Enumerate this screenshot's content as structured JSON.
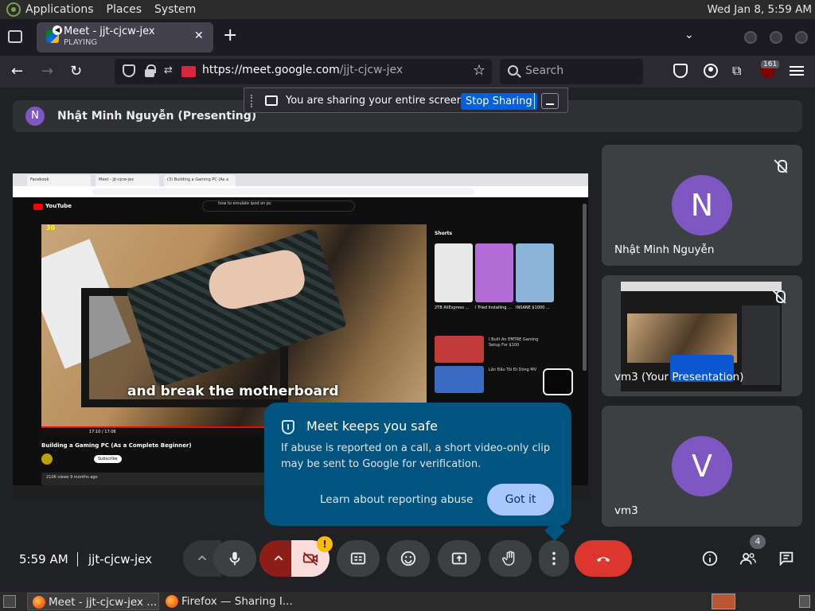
{
  "desktop": {
    "menus": [
      "Applications",
      "Places",
      "System"
    ],
    "clock": "Wed Jan  8,  5:59 AM"
  },
  "browser": {
    "tab": {
      "title": "Meet - jjt-cjcw-jex",
      "subtitle": "PLAYING"
    },
    "url_host": "https://meet.google.com",
    "url_path": "/jjt-cjcw-jex",
    "search_placeholder": "Search",
    "ublock_count": "161"
  },
  "share_banner": {
    "text": "You are sharing your entire screen.",
    "stop_label": "Stop Sharing"
  },
  "presenter": {
    "initial": "N",
    "label": "Nhật Minh Nguyễn (Presenting)"
  },
  "presentation": {
    "tabs": [
      "Facebook",
      "Meet - jjt-cjcw-jex",
      "(3) Building a Gaming PC (As a"
    ],
    "youtube_label": "YouTube",
    "search_query": "how to emulate ipod on pc",
    "badge": "30",
    "subtitle": "and break the motherboard",
    "time": "17:10 / 17:06",
    "video_title": "Building a Gaming PC (As a Complete Beginner)",
    "subscribe": "Subscribe",
    "views": "210K views  9 months ago",
    "shorts_title": "Shorts",
    "shorts": [
      {
        "label": "2TB AliExpress ...",
        "color": "#e8e8e8"
      },
      {
        "label": "I Tried Installing ...",
        "color": "#b36bd6"
      },
      {
        "label": "INSANE $1000 ...",
        "color": "#8bb4d8"
      }
    ],
    "side_videos": [
      {
        "label": "I Built An EMTRE Gaming Setup For $100",
        "color": "#c23a3a"
      },
      {
        "label": "Lần Đầu Tôi Đi Dòng MV",
        "color": "#3a6ac2"
      }
    ],
    "progress_fraction": 0.97
  },
  "participants": [
    {
      "name": "Nhật Minh Nguyễn",
      "initial": "N"
    },
    {
      "name": "vm3 (Your Presentation)"
    },
    {
      "name": "vm3",
      "initial": "V"
    }
  ],
  "safe_popup": {
    "title": "Meet keeps you safe",
    "body": "If abuse is reported on a call, a short video-only clip may be sent to Google for verification.",
    "learn_label": "Learn about reporting abuse",
    "got_label": "Got it"
  },
  "controls": {
    "time": "5:59 AM",
    "meeting_code": "jjt-cjcw-jex",
    "people_count": "4",
    "warning_mark": "!"
  },
  "taskbar": {
    "tasks": [
      "Meet - jjt-cjcw-jex ...",
      "Firefox — Sharing I..."
    ]
  },
  "icons": {
    "mic": "mic-icon",
    "camera_off": "camera-off-icon",
    "captions": "captions-icon",
    "emoji": "emoji-icon",
    "present": "present-icon",
    "raise_hand": "raise-hand-icon",
    "more": "more-vert-icon",
    "hangup": "hangup-icon",
    "info": "info-icon",
    "people": "people-icon",
    "chat": "chat-icon"
  }
}
